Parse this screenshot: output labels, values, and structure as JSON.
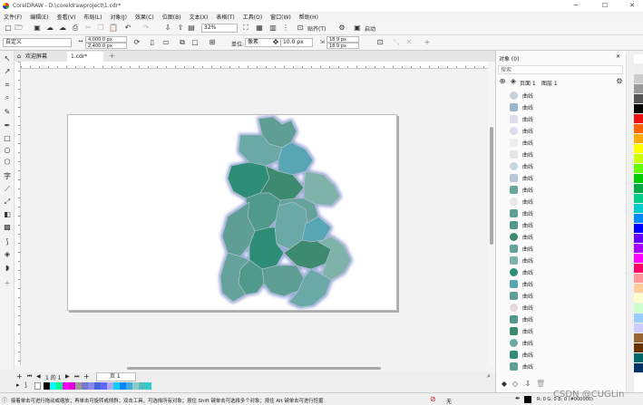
{
  "window": {
    "title": "CorelDRAW - D:\\coreldrawproject\\1.cdr*"
  },
  "menu": [
    "文件(F)",
    "编辑(E)",
    "查看(V)",
    "布局(L)",
    "对象(J)",
    "效果(C)",
    "位图(B)",
    "文本(X)",
    "表格(T)",
    "工具(O)",
    "窗口(W)",
    "帮助(H)"
  ],
  "toolbar": {
    "zoom": "32%",
    "snap_label": "贴齐(T)",
    "launch_label": "启动"
  },
  "propbar": {
    "preset": "自定义",
    "width": "4,000.0 px",
    "height": "2,400.0 px",
    "units_label": "单位:",
    "units_value": "像素",
    "nudge": "10.0 px",
    "dup_x": "18.9 px",
    "dup_y": "18.9 px"
  },
  "tabs": {
    "welcome": "欢迎屏幕",
    "doc": "1.cdr*"
  },
  "pagenav": {
    "count": "1 的 1",
    "page_tab": "页 1"
  },
  "docker": {
    "title": "对象 (0)",
    "search_placeholder": "搜索",
    "page_label": "页面 1",
    "layer_label": "图层 1",
    "item_label": "曲线",
    "item_count": 24
  },
  "map_regions_fill": [
    "#5f9e95",
    "#6aa9a6",
    "#58a6b4",
    "#2f8d76",
    "#3e8a6f",
    "#7fb3aa",
    "#4f9a8a",
    "#66a29c"
  ],
  "status": {
    "hint": "接着单击可进行拖动或缩放；再单击可旋转或倾斜；双击工具，可选择所有对象；按住 Shift 键单击可选择多个对象；按住 Alt 键单击可进行挖掘",
    "fill_none": "无",
    "color_readout": "R: 0 G: 0 B: 0 (#000000)"
  },
  "watermark": "CSDN @CUGLin"
}
